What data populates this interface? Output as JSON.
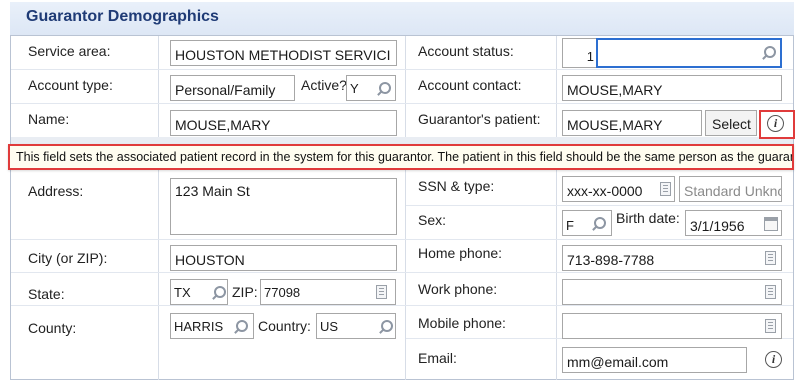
{
  "section": {
    "title": "Guarantor Demographics"
  },
  "left": {
    "service_area": {
      "label": "Service area:",
      "value": "HOUSTON METHODIST SERVICI"
    },
    "account_type": {
      "label": "Account type:",
      "value": "Personal/Family",
      "active_label": "Active?",
      "active_value": "Y"
    },
    "name": {
      "label": "Name:",
      "value": "MOUSE,MARY"
    },
    "address": {
      "label": "Address:",
      "value": "123 Main St"
    },
    "city": {
      "label": "City (or ZIP):",
      "value": "HOUSTON"
    },
    "state": {
      "label": "State:",
      "value": "TX",
      "zip_label": "ZIP:",
      "zip_value": "77098"
    },
    "county": {
      "label": "County:",
      "value": "HARRIS",
      "country_label": "Country:",
      "country_value": "US"
    }
  },
  "right": {
    "account_status": {
      "label": "Account status:",
      "value": "1"
    },
    "account_contact": {
      "label": "Account contact:",
      "value": "MOUSE,MARY"
    },
    "guarantor_patient": {
      "label": "Guarantor's patient:",
      "value": "MOUSE,MARY",
      "button": "Select"
    },
    "ssn": {
      "label": "SSN & type:",
      "value": "xxx-xx-0000",
      "type_value": "Standard Unknc"
    },
    "sex": {
      "label": "Sex:",
      "value": "F",
      "birth_label": "Birth date:",
      "birth_value": "3/1/1956"
    },
    "home_phone": {
      "label": "Home phone:",
      "value": "713-898-7788"
    },
    "work_phone": {
      "label": "Work phone:",
      "value": ""
    },
    "mobile_phone": {
      "label": "Mobile phone:",
      "value": ""
    },
    "email": {
      "label": "Email:",
      "value": "mm@email.com"
    }
  },
  "tooltip": {
    "text": "This field sets the associated patient record in the system for this guarantor. The patient in this field should be the same person as the guarantor."
  },
  "colors": {
    "header_text": "#1f3b76",
    "highlight": "#e03b3b",
    "focus": "#2d6fd1"
  }
}
